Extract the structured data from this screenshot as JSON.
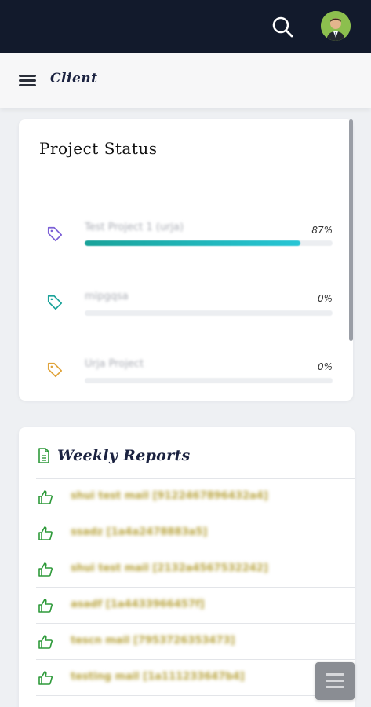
{
  "header": {
    "search_icon": "search-icon",
    "avatar_icon": "user-avatar"
  },
  "subheader": {
    "menu_icon": "hamburger-menu-icon",
    "title": "Client"
  },
  "project_status": {
    "title": "Project Status",
    "projects": [
      {
        "name": "Test Project 1 (urja)",
        "percent_label": "87%",
        "progress": 0.87,
        "tag_color": "#7b5fd6"
      },
      {
        "name": "mipgqsa",
        "percent_label": "0%",
        "progress": 0,
        "tag_color": "#1ba39a"
      },
      {
        "name": "Urja Project",
        "percent_label": "0%",
        "progress": 0,
        "tag_color": "#e0a33a"
      }
    ]
  },
  "weekly_reports": {
    "title": "Weekly Reports",
    "items": [
      {
        "text": "shui test mail [9122467896432a4]"
      },
      {
        "text": "ssadz [1a4a2478883a5]"
      },
      {
        "text": "shui test mail [2132a4567532242]"
      },
      {
        "text": "asadf [1a4433966457f]"
      },
      {
        "text": "tescn mail [7953726353473]"
      },
      {
        "text": "testing mail [1a111233647b4]"
      }
    ]
  },
  "colors": {
    "topbar": "#121a2c",
    "progress_start": "#1aa39a",
    "progress_end": "#27c6d6",
    "report_text": "#b7a23b",
    "thumb_icon": "#2e9a3a"
  }
}
